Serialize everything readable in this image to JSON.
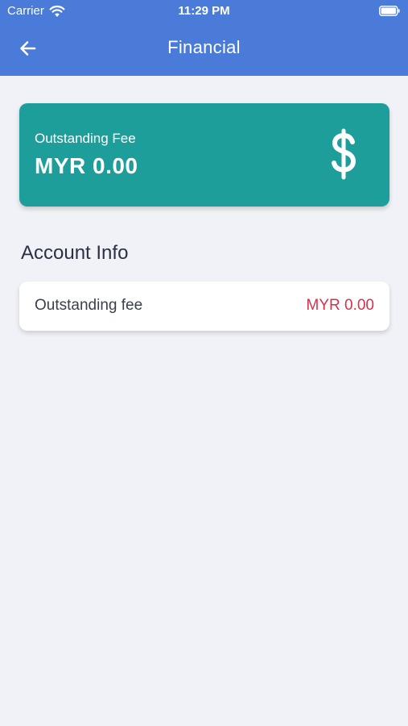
{
  "status_bar": {
    "carrier": "Carrier",
    "time": "11:29 PM",
    "wifi_icon": "wifi-icon",
    "battery_icon": "battery-icon"
  },
  "nav": {
    "title": "Financial",
    "back_icon": "arrow-left-icon"
  },
  "fee_card": {
    "label": "Outstanding Fee",
    "amount": "MYR 0.00",
    "icon": "dollar-icon",
    "color": "#1d9e9b"
  },
  "account_info": {
    "title": "Account Info",
    "rows": [
      {
        "label": "Outstanding fee",
        "value": "MYR 0.00",
        "value_color": "#d9304a"
      }
    ]
  },
  "colors": {
    "header": "#4a7bd8",
    "background": "#f0f2f7"
  }
}
